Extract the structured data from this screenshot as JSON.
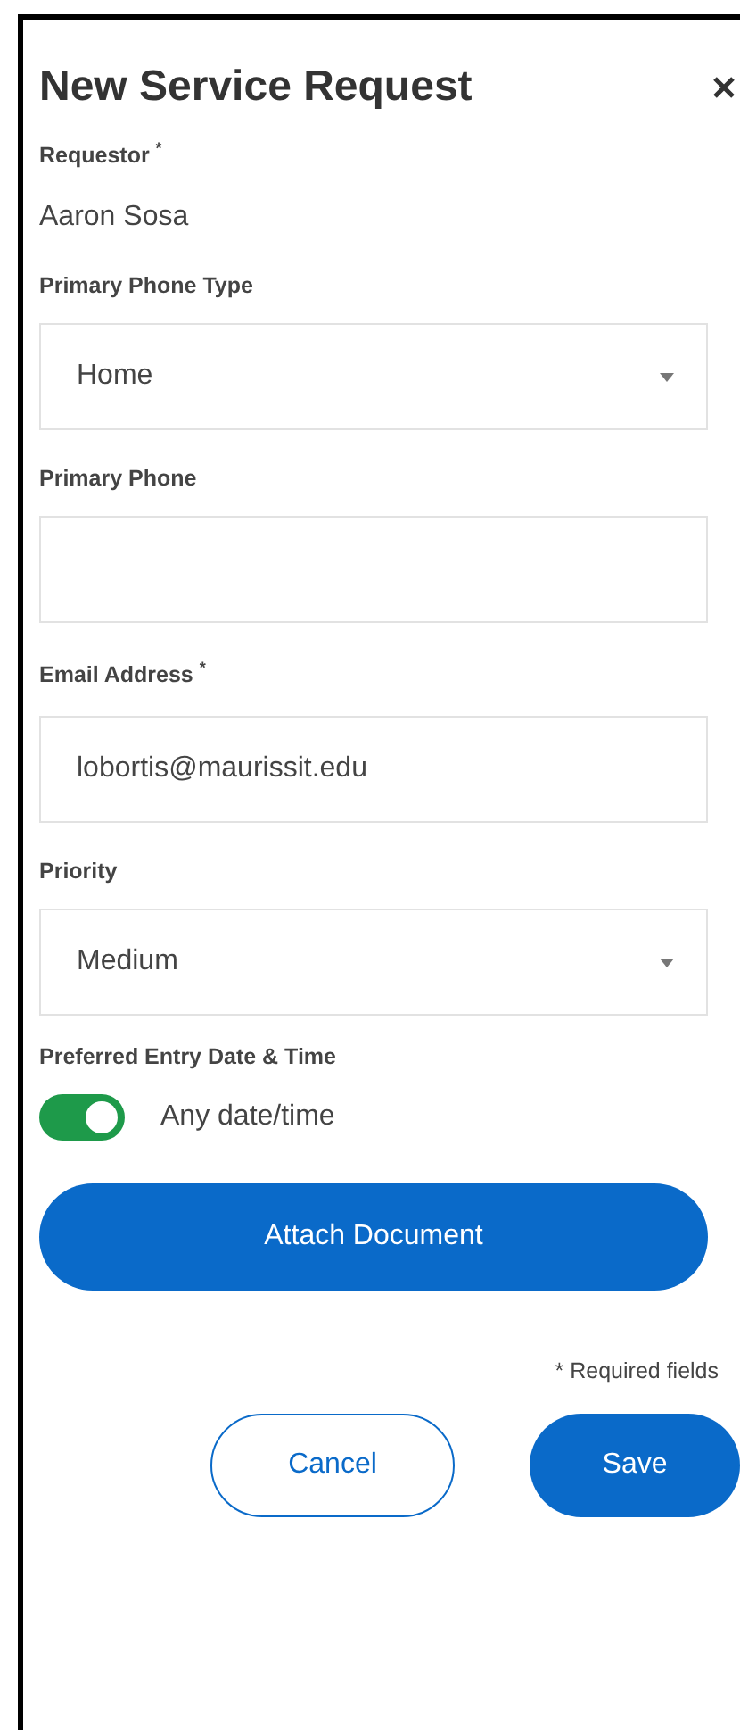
{
  "dialog": {
    "title": "New Service Request"
  },
  "fields": [
    {
      "kind": "static",
      "label": "Requestor $^{*}$",
      "value": "Aaron Sosa"
    },
    {
      "kind": "select",
      "label": "Primary Phone Type",
      "value": "Home"
    },
    {
      "kind": "text",
      "label": "Primary Phone"
    },
    {
      "kind": "text",
      "label": "Email Address $^{*}$",
      "value": "lobortis@maurissit.edu"
    },
    {
      "kind": "select",
      "label": "Priority",
      "value": "Medium"
    },
    {
      "kind": "toggle",
      "label": "Preferred Entry Date & Time",
      "option": "Any date/time",
      "on": true
    }
  ],
  "attach_button": "Attach Document",
  "required_note": "* Required fields",
  "buttons": [
    {
      "kind": "secondary",
      "label": "Cancel"
    },
    {
      "kind": "primary",
      "label": "Save"
    }
  ]
}
